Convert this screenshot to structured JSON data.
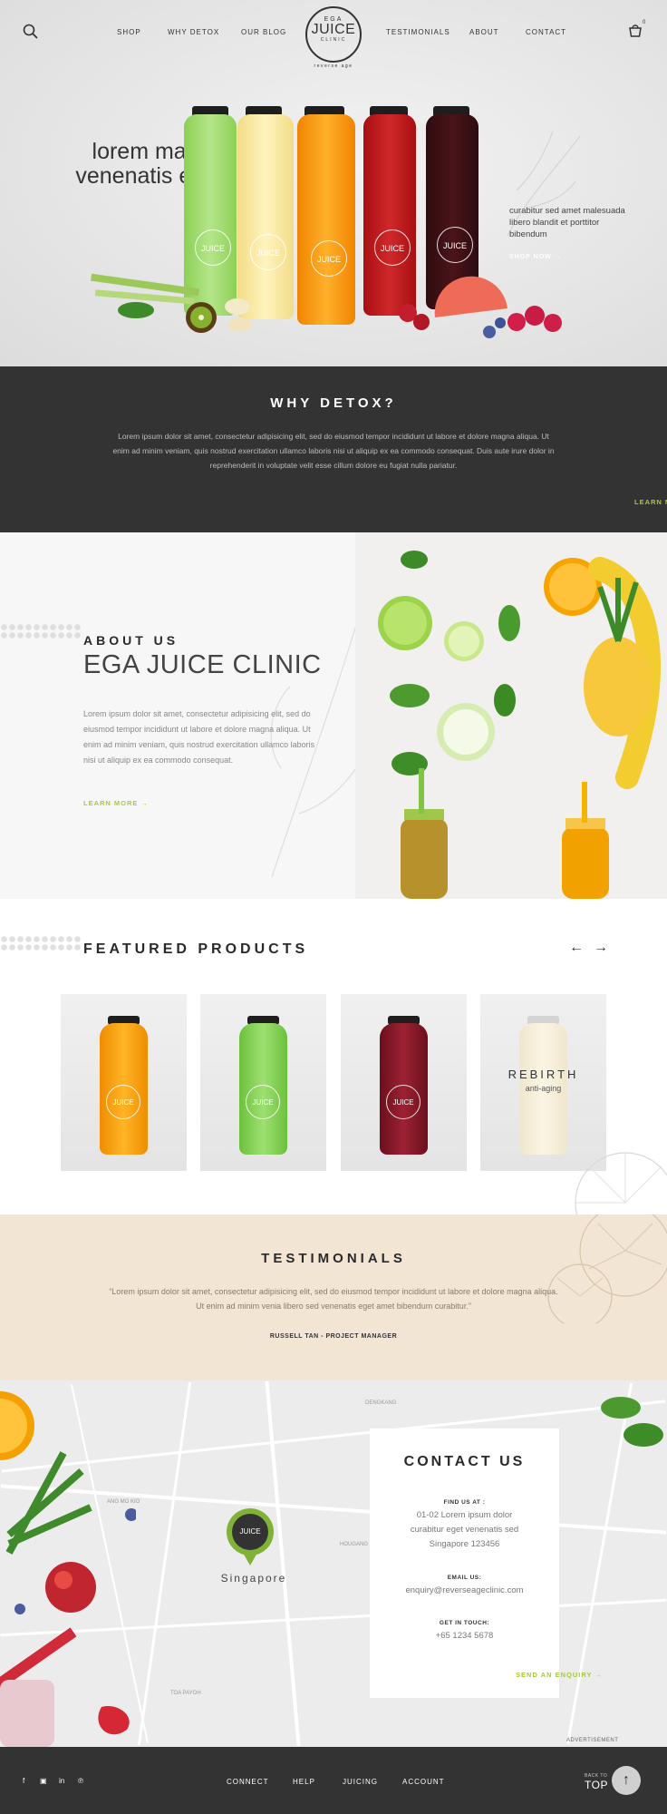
{
  "header": {
    "nav_left": [
      "SHOP",
      "WHY DETOX",
      "OUR BLOG"
    ],
    "nav_right": [
      "TESTIMONIALS",
      "ABOUT",
      "CONTACT"
    ],
    "logo": {
      "top": "EGA",
      "main": "JUICE",
      "sub": "CLINIC",
      "tagline": "reverse age"
    },
    "cart_count": "0"
  },
  "hero": {
    "title": "lorem mauris venenatis eget",
    "text": "curabitur sed amet malesuada libero blandit et porttitor bibendum",
    "cta": "SHOP NOW"
  },
  "why_detox": {
    "title": "WHY DETOX?",
    "body": "Lorem ipsum dolor sit amet, consectetur adipisicing elit, sed do eiusmod tempor incididunt ut labore et dolore magna aliqua. Ut enim ad minim veniam, quis nostrud exercitation ullamco laboris nisi ut aliquip ex ea commodo consequat. Duis aute irure dolor in reprehenderit in voluptate velit esse cillum dolore eu fugiat nulla pariatur.",
    "cta": "LEARN MORE"
  },
  "about": {
    "eyebrow": "ABOUT US",
    "title": "EGA JUICE CLINIC",
    "body": "Lorem ipsum dolor sit amet, consectetur adipisicing elit, sed do eiusmod tempor incididunt ut labore et dolore magna aliqua. Ut enim ad minim veniam, quis nostrud exercitation ullamco laboris nisi ut aliquip ex ea commodo consequat.",
    "cta": "LEARN MORE"
  },
  "featured": {
    "title": "FEATURED PRODUCTS",
    "prev_icon": "arrow-left-icon",
    "next_icon": "arrow-right-icon",
    "products": [
      {
        "label": "JUICE",
        "color": "#f5a100"
      },
      {
        "label": "JUICE",
        "color": "#7ed24d"
      },
      {
        "label": "JUICE",
        "color": "#8b1a2a"
      },
      {
        "label": "REBIRTH",
        "subtitle": "anti-aging",
        "color": "#f3ecd7"
      }
    ]
  },
  "testimonials": {
    "title": "TESTIMONIALS",
    "quote": "“Lorem ipsum dolor sit amet, consectetur adipisicing elit, sed do eiusmod tempor incididunt ut labore et dolore magna aliqua. Ut enim ad minim venia libero sed venenatis eget amet bibendum curabitur.”",
    "author": "RUSSELL TAN - PROJECT MANAGER"
  },
  "contact": {
    "title": "CONTACT US",
    "find_label": "FIND US AT :",
    "address": [
      "01-02 Lorem ipsum dolor",
      "curabitur eget venenatis sed",
      "Singapore 123456"
    ],
    "email_label": "EMAIL US:",
    "email": "enquiry@reverseageclinic.com",
    "touch_label": "GET IN TOUCH:",
    "phone": "+65 1234 5678",
    "cta": "SEND AN ENQUIRY",
    "map_pin_label": "Singapore",
    "map_labels": [
      "DENGKANG",
      "ANG MO KIO",
      "HOUGANG",
      "TOA PAYOH"
    ],
    "ad_label": "ADVERTISEMENT"
  },
  "footer": {
    "social_icons": [
      "facebook-icon",
      "instagram-icon",
      "linkedin-icon",
      "pinterest-icon"
    ],
    "links": [
      "CONNECT",
      "HELP",
      "JUICING",
      "ACCOUNT"
    ],
    "back_small": "BACK TO",
    "back_big": "TOP"
  },
  "colors": {
    "accent_green": "#a6c93b",
    "dark": "#333333",
    "testimonial_bg": "#f3e5d3"
  }
}
